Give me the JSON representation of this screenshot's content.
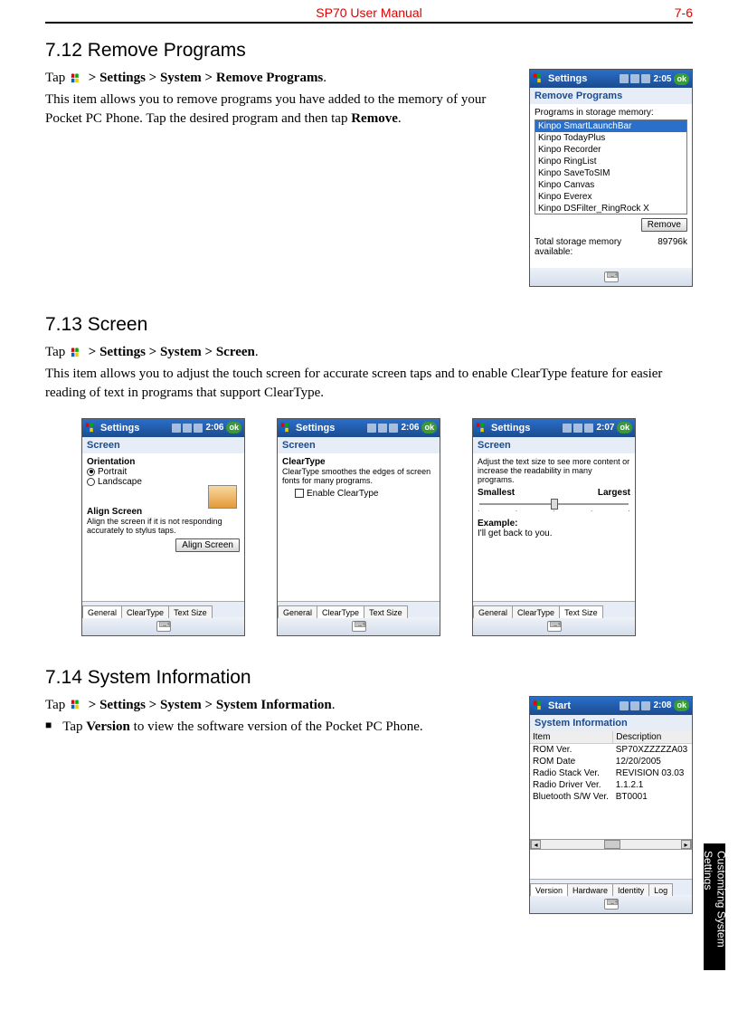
{
  "header": {
    "title": "SP70 User Manual",
    "page": "7-6"
  },
  "sideTab": "Customizng\nSystem Settings",
  "sections": {
    "s712": {
      "heading": "7.12    Remove Programs",
      "tap_prefix": "Tap ",
      "nav": " > Settings > System > Remove Programs",
      "body1": "This item allows you to remove programs you have added to the memory of your Pocket PC Phone. Tap the desired program and then tap ",
      "body1_bold": "Remove",
      "screen": {
        "title": "Settings",
        "clock": "2:05",
        "ok": "ok",
        "sub": "Remove Programs",
        "label": "Programs in storage memory:",
        "items": [
          "Kinpo SmartLaunchBar",
          "Kinpo TodayPlus",
          "Kinpo Recorder",
          "Kinpo RingList",
          "Kinpo SaveToSIM",
          "Kinpo Canvas",
          "Kinpo Everex",
          "Kinpo DSFilter_RingRock X"
        ],
        "remove_btn": "Remove",
        "storage_label": "Total storage memory available:",
        "storage_value": "89796k"
      }
    },
    "s713": {
      "heading": "7.13    Screen",
      "tap_prefix": "Tap ",
      "nav": " > Settings > System > Screen",
      "body": "This item allows you to adjust the touch screen for accurate screen taps and to enable ClearType feature for easier reading of text in programs that support ClearType.",
      "shot1": {
        "title": "Settings",
        "clock": "2:06",
        "ok": "ok",
        "sub": "Screen",
        "orientation_label": "Orientation",
        "opt1": "Portrait",
        "opt2": "Landscape",
        "align_head": "Align Screen",
        "align_body": "Align the screen if it is not responding accurately to stylus taps.",
        "align_btn": "Align Screen",
        "tabs": [
          "General",
          "ClearType",
          "Text Size"
        ]
      },
      "shot2": {
        "title": "Settings",
        "clock": "2:06",
        "ok": "ok",
        "sub": "Screen",
        "ct_head": "ClearType",
        "ct_body": "ClearType smoothes the edges of screen fonts for many programs.",
        "ct_check": "Enable ClearType",
        "tabs": [
          "General",
          "ClearType",
          "Text Size"
        ]
      },
      "shot3": {
        "title": "Settings",
        "clock": "2:07",
        "ok": "ok",
        "sub": "Screen",
        "desc": "Adjust the text size to see more content or increase the readability in many programs.",
        "smallest": "Smallest",
        "largest": "Largest",
        "example_label": "Example:",
        "example_text": "I'll get back to you.",
        "tabs": [
          "General",
          "ClearType",
          "Text Size"
        ]
      }
    },
    "s714": {
      "heading": "7.14    System Information",
      "tap_prefix": "Tap ",
      "nav": " > Settings > System > System Information",
      "bullet_prefix": "Tap ",
      "bullet_bold": "Version",
      "bullet_suffix": " to view the software version of the Pocket PC Phone.",
      "screen": {
        "title": "Start",
        "clock": "2:08",
        "ok": "ok",
        "sub": "System Information",
        "col1": "Item",
        "col2": "Description",
        "rows": [
          [
            "ROM Ver.",
            "SP70XZZZZZA03"
          ],
          [
            "ROM Date",
            "12/20/2005"
          ],
          [
            "Radio Stack Ver.",
            "REVISION 03.03"
          ],
          [
            "Radio Driver Ver.",
            "1.1.2.1"
          ],
          [
            "Bluetooth S/W Ver.",
            "BT0001"
          ]
        ],
        "tabs": [
          "Version",
          "Hardware",
          "Identity",
          "Log"
        ]
      }
    }
  }
}
